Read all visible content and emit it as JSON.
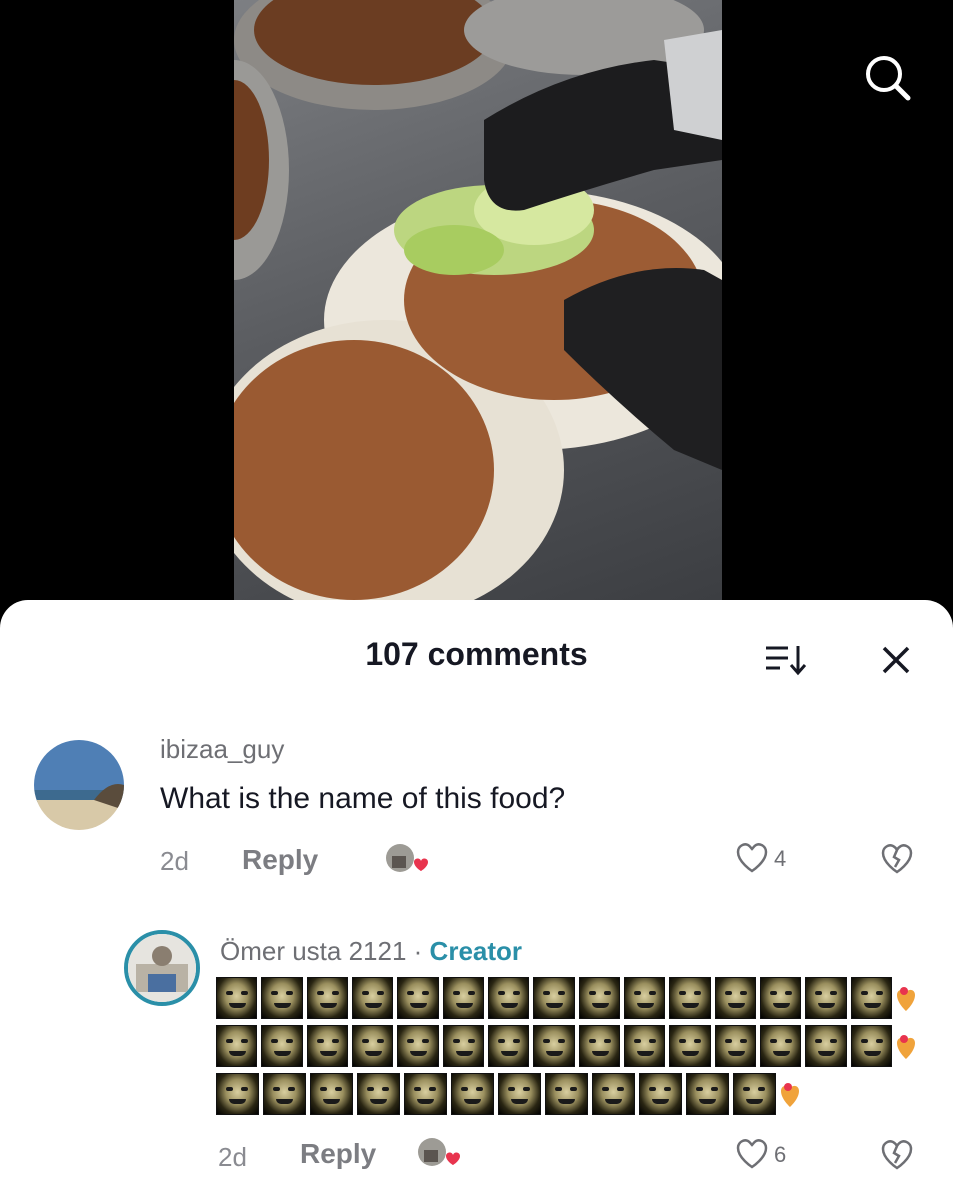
{
  "sheet": {
    "comment_count": "107 comments"
  },
  "comments": [
    {
      "username": "ibizaa_guy",
      "text": "What is the name of this food?",
      "time": "2d",
      "reply_label": "Reply",
      "like_count": "4"
    }
  ],
  "reply": {
    "username": "Ömer usta 2121",
    "separator": " · ",
    "badge": "Creator",
    "time": "2d",
    "reply_label": "Reply",
    "like_count": "6"
  },
  "colors": {
    "creator_badge": "#2a8fa8",
    "liked_heart": "#e8344e"
  }
}
